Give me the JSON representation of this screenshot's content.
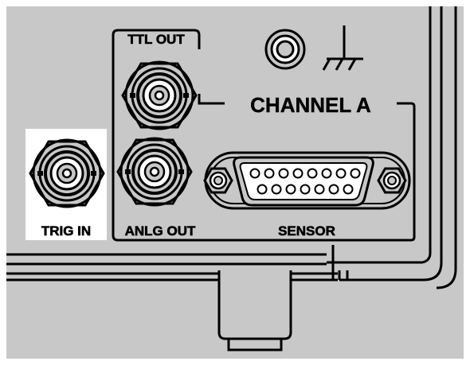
{
  "labels": {
    "ttl_out": "TTL OUT",
    "channel_a": "CHANNEL A",
    "trig_in": "TRIG IN",
    "anlg_out": "ANLG OUT",
    "sensor": "SENSOR"
  },
  "colors": {
    "panel": "#c8c8c8",
    "highlight": "#ffffff",
    "line": "#000000"
  },
  "icons": {
    "ground": "chassis-ground-icon"
  }
}
